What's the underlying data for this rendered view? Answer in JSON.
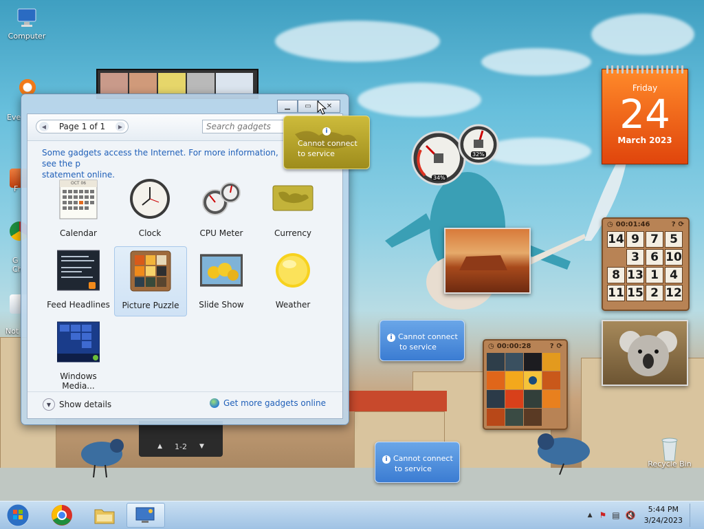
{
  "desktop": {
    "icons": [
      {
        "label": "Computer",
        "icon": "computer-icon"
      },
      {
        "label": "Recycle Bin",
        "icon": "recycle-bin-icon"
      }
    ],
    "partial_labels": [
      "Eve",
      "F",
      "G Ch",
      "Not"
    ]
  },
  "gadgets_window": {
    "pager": "Page 1 of 1",
    "search_placeholder": "Search gadgets",
    "info_text": "Some gadgets access the Internet.  For more information, see the p",
    "info_text2": "statement online.",
    "gadgets": [
      {
        "label": "Calendar",
        "icon": "calendar-icon"
      },
      {
        "label": "Clock",
        "icon": "clock-icon"
      },
      {
        "label": "CPU Meter",
        "icon": "cpu-meter-icon"
      },
      {
        "label": "Currency",
        "icon": "currency-icon"
      },
      {
        "label": "Feed Headlines",
        "icon": "feed-headlines-icon"
      },
      {
        "label": "Picture Puzzle",
        "icon": "picture-puzzle-icon",
        "selected": true
      },
      {
        "label": "Slide Show",
        "icon": "slide-show-icon"
      },
      {
        "label": "Weather",
        "icon": "weather-icon"
      },
      {
        "label": "Windows Media...",
        "icon": "windows-media-icon"
      }
    ],
    "show_details": "Show details",
    "get_more": "Get more gadgets online",
    "calendar_thumb_month": "OCT 06"
  },
  "currency_gadget": {
    "line1": "Cannot connect",
    "line2": "to service"
  },
  "weather_gadget_1": {
    "line1": "Cannot connect",
    "line2": "to service"
  },
  "weather_gadget_2": {
    "line1": "Cannot connect",
    "line2": "to service"
  },
  "cpu_gadget": {
    "cpu_percent": "34%",
    "memory_percent": "32%"
  },
  "calendar_gadget": {
    "weekday": "Friday",
    "day": "24",
    "month_year": "March 2023"
  },
  "puzzle_gadget_numbers": {
    "timer": "00:01:46",
    "cells": [
      "14",
      "9",
      "7",
      "5",
      "",
      "3",
      "6",
      "10",
      "8",
      "13",
      "1",
      "4",
      "11",
      "15",
      "2",
      "12"
    ]
  },
  "puzzle_gadget_picture": {
    "timer": "00:00:28"
  },
  "slideshow_pager": {
    "label": "1-2"
  },
  "taskbar": {
    "time": "5:44 PM",
    "date": "3/24/2023"
  },
  "colors": {
    "accent_blue": "#1f5fb8",
    "calendar_orange": "#e0450c",
    "taskbar": "#b4d1ec"
  }
}
